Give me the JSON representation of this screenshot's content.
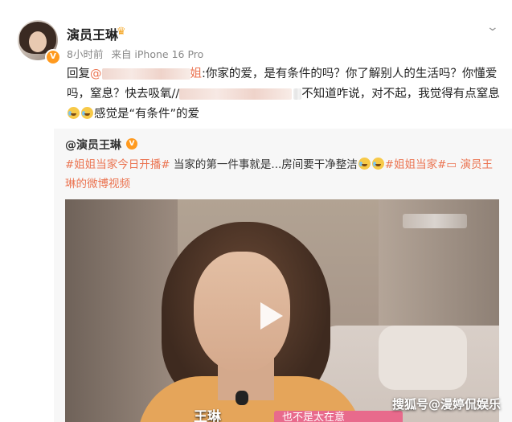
{
  "post": {
    "author": "演员王琳",
    "author_icon": "crown-icon",
    "time": "8小时前",
    "source": "来自 iPhone 16 Pro",
    "reply_prefix": "回复",
    "reply_mention": "@",
    "reply_mention_tail": "姐",
    "reply_body_1": ":你家的爱，是有条件的吗？你了解别人的生活吗？你懂爱吗，窒息？快去吸氧//",
    "reply_body_2": "不知道咋说，对不起，我觉得有点窒息",
    "reply_body_3": "感觉是“有条件”的爱"
  },
  "repost": {
    "author": "@演员王琳",
    "tag1": "#姐姐当家今日开播#",
    "text": " 当家的第一件事就是...房间要干净整洁",
    "tag2": "#姐姐当家#",
    "video_link": " 演员王琳的微博视频",
    "video": {
      "caption_name": "王琳",
      "caption_text": "也不是太在意"
    }
  },
  "watermark": "搜狐号@漫婷侃娱乐",
  "colors": {
    "accent": "#eb7350",
    "badge": "#ff9a1f"
  }
}
